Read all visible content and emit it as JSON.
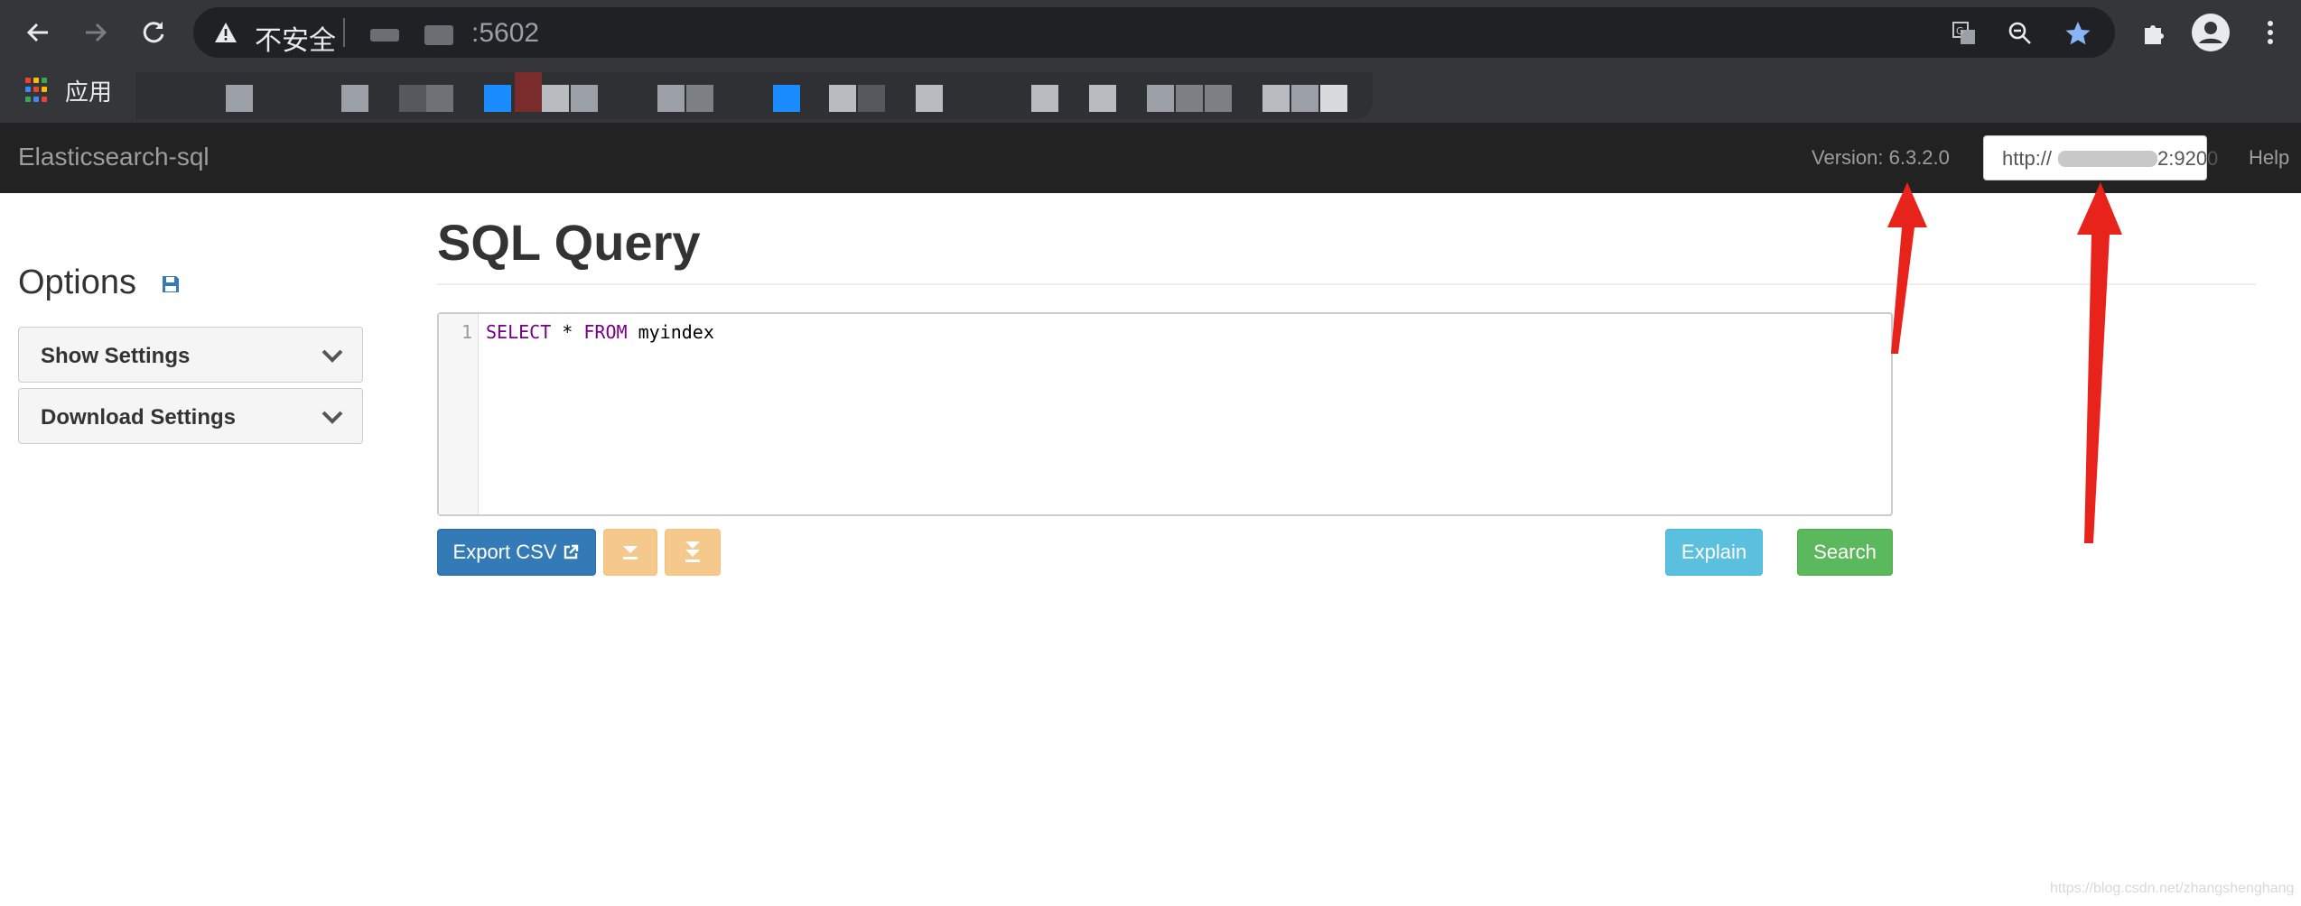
{
  "browser": {
    "security_label": "不安全",
    "url_suffix": ":5602",
    "bookmarks_apps_label": "应用"
  },
  "navbar": {
    "brand": "Elasticsearch-sql",
    "version": "Version: 6.3.2.0",
    "host_prefix": "http://",
    "host_port": "2:9200",
    "help": "Help"
  },
  "options": {
    "title": "Options",
    "panels": [
      {
        "label": "Show Settings"
      },
      {
        "label": "Download Settings"
      }
    ]
  },
  "main": {
    "title": "SQL Query",
    "editor": {
      "line_number": "1",
      "keyword_select": "SELECT",
      "star": " * ",
      "keyword_from": "FROM",
      "table": " myindex"
    },
    "buttons": {
      "export": "Export CSV",
      "explain": "Explain",
      "search": "Search"
    }
  },
  "watermark": "https://blog.csdn.net/zhangshenghang",
  "colors": {
    "navbar_bg": "#222222",
    "primary": "#337ab7",
    "warning": "#f0ad4e",
    "info": "#5bc0de",
    "success": "#5cb85c",
    "annotation_arrow": "#e8231b"
  }
}
